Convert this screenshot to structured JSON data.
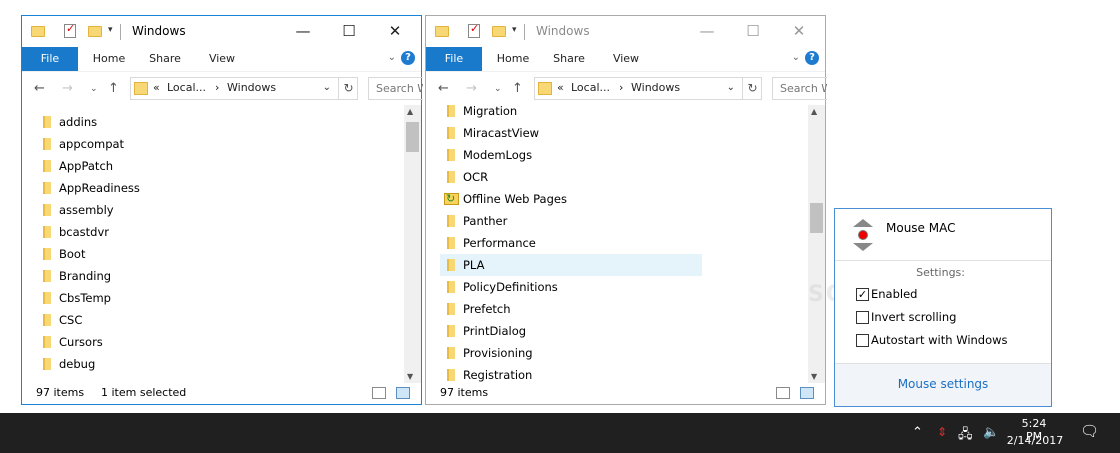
{
  "colors": {
    "accent": "#1979ca",
    "selection": "#e5f3fb",
    "folder": "#f8d775",
    "taskbar": "#202020",
    "link": "#1a6fc4"
  },
  "win1": {
    "title": "Windows",
    "tabs": [
      "File",
      "Home",
      "Share",
      "View"
    ],
    "breadcrumb": {
      "prefix": "«",
      "seg1": "Local...",
      "sep": "›",
      "seg2": "Windows"
    },
    "search_placeholder": "Search Windows",
    "files": [
      "addins",
      "appcompat",
      "AppPatch",
      "AppReadiness",
      "assembly",
      "bcastdvr",
      "Boot",
      "Branding",
      "CbsTemp",
      "CSC",
      "Cursors",
      "debug"
    ],
    "status": {
      "count": "97 items",
      "selection": "1 item selected"
    }
  },
  "win2": {
    "title": "Windows",
    "tabs": [
      "File",
      "Home",
      "Share",
      "View"
    ],
    "breadcrumb": {
      "prefix": "«",
      "seg1": "Local...",
      "sep": "›",
      "seg2": "Windows"
    },
    "search_placeholder": "Search Windows",
    "files": [
      "Migration",
      "MiracastView",
      "ModemLogs",
      "OCR",
      "Offline Web Pages",
      "Panther",
      "Performance",
      "PLA",
      "PolicyDefinitions",
      "Prefetch",
      "PrintDialog",
      "Provisioning",
      "Registration"
    ],
    "selected": "PLA",
    "status": {
      "count": "97 items"
    }
  },
  "mouse_mac": {
    "title": "Mouse MAC",
    "settings_label": "Settings:",
    "options": [
      {
        "label": "Enabled",
        "checked": true
      },
      {
        "label": "Invert scrolling",
        "checked": false
      },
      {
        "label": "Autostart with Windows",
        "checked": false
      }
    ],
    "settings_link": "Mouse settings"
  },
  "taskbar": {
    "time": "5:24 PM",
    "date": "2/14/2017"
  },
  "watermark": "SOFTPEDIA"
}
